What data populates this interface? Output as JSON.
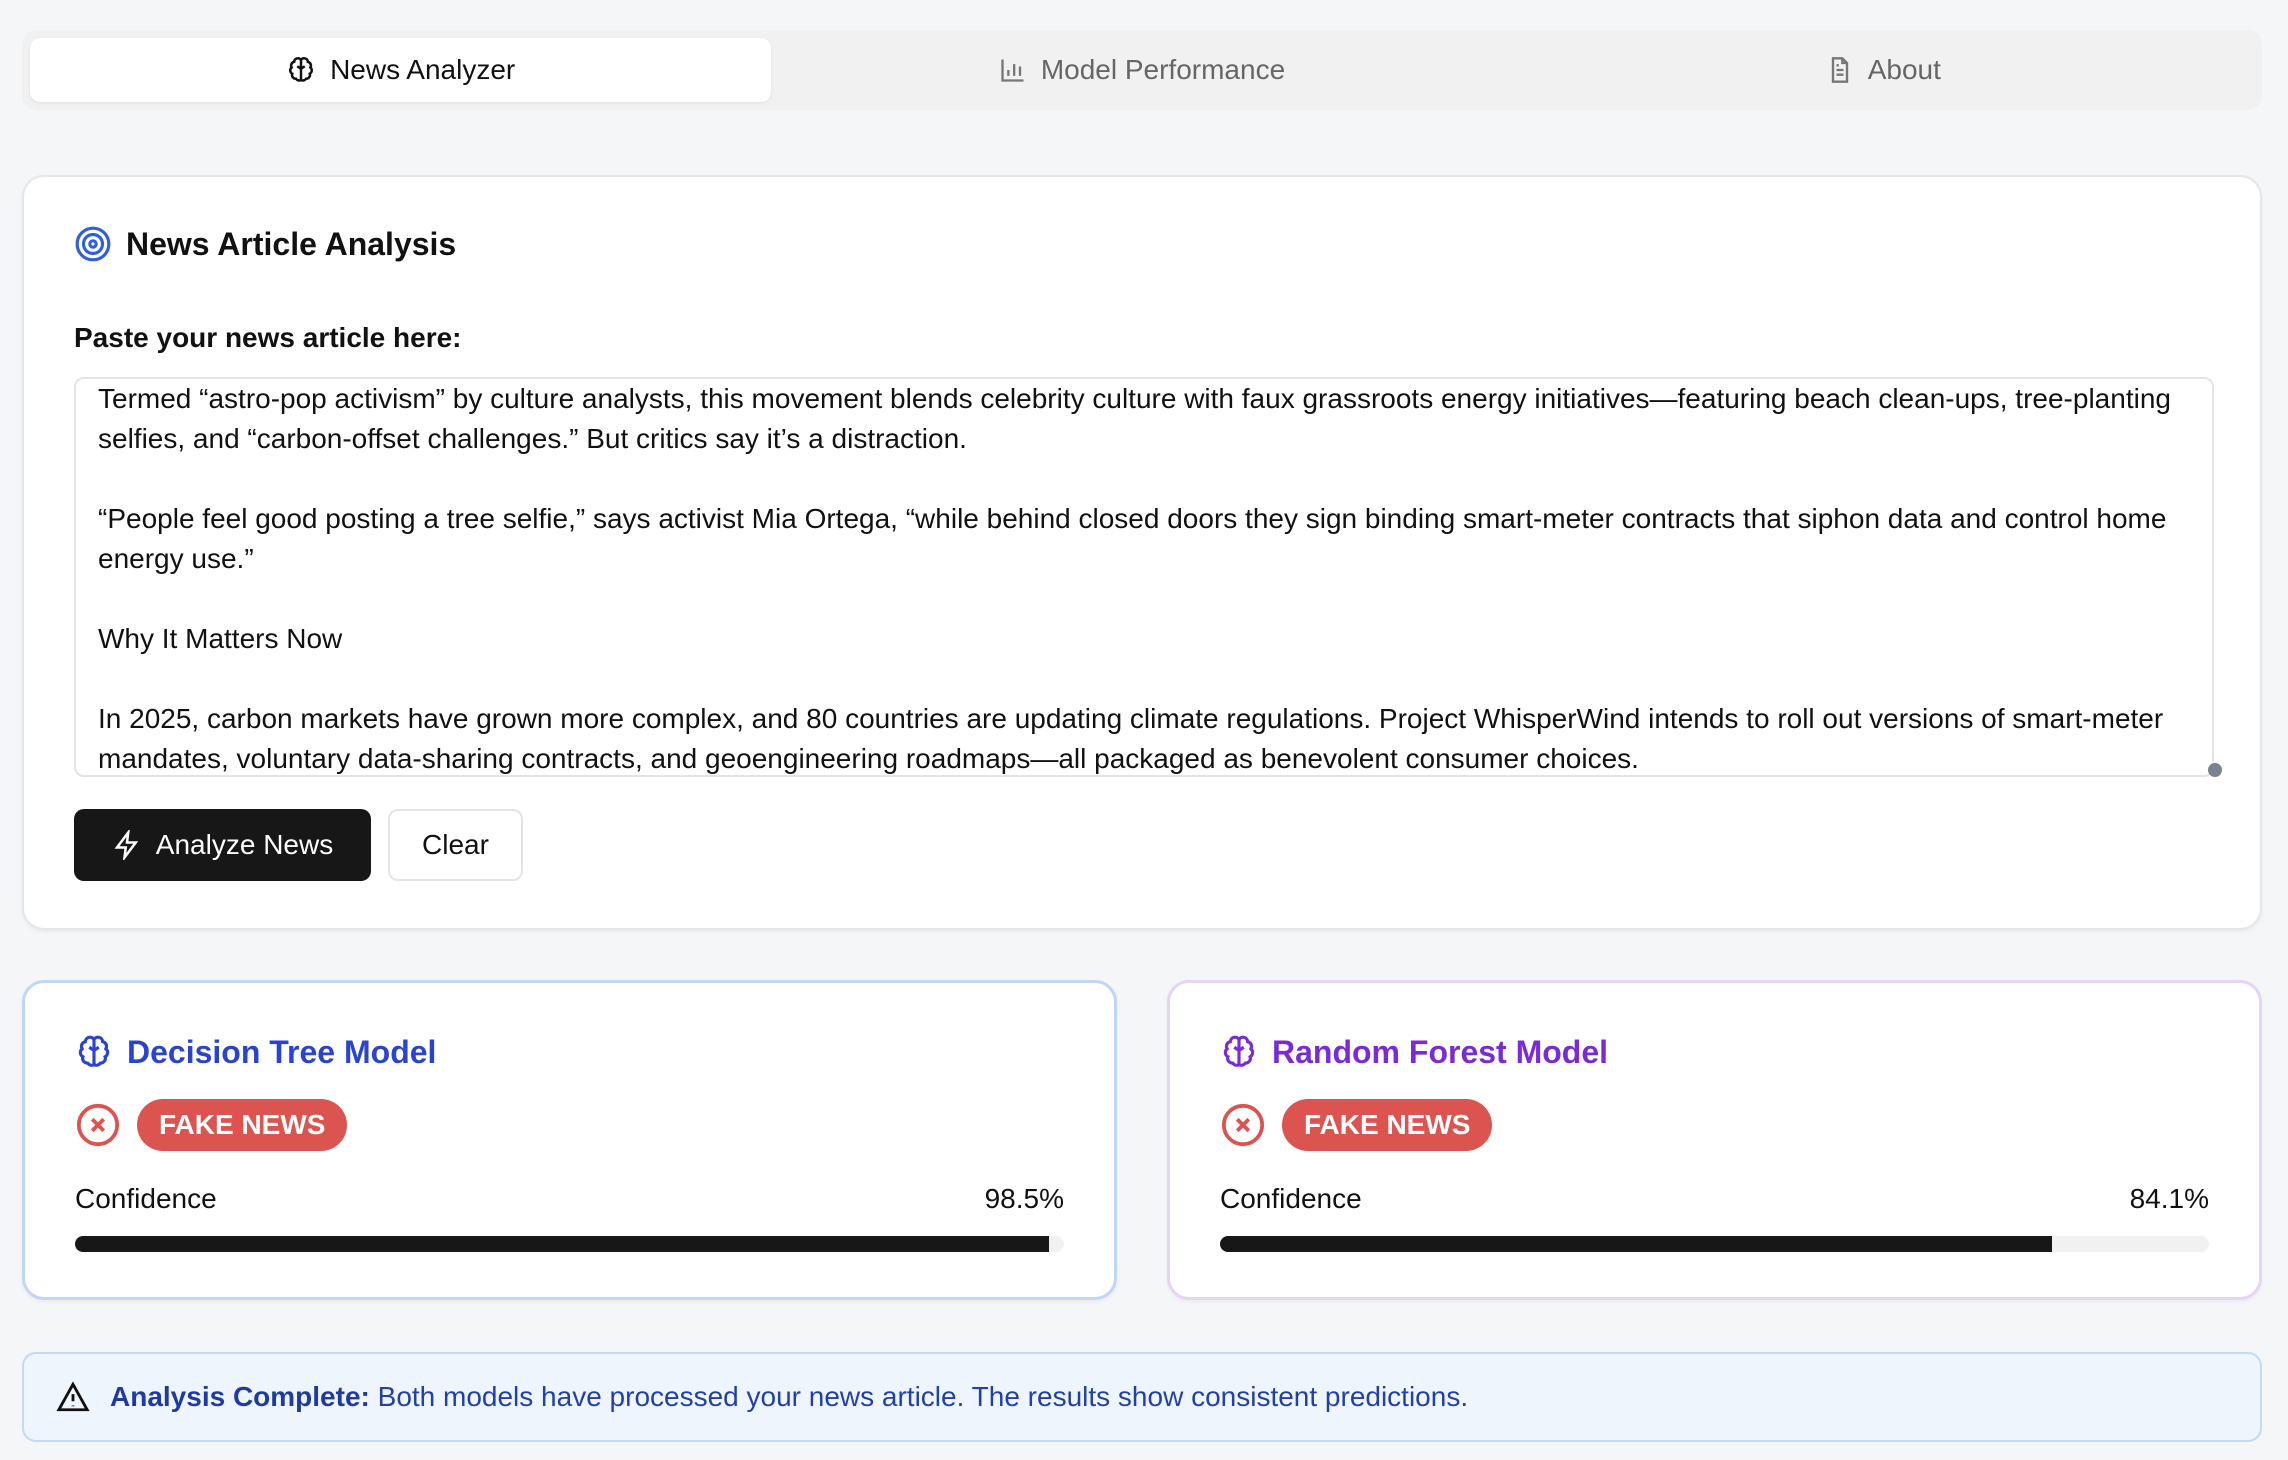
{
  "tabs": [
    {
      "label": "News Analyzer",
      "icon": "brain-icon",
      "active": true
    },
    {
      "label": "Model Performance",
      "icon": "bar-chart-icon"
    },
    {
      "label": "About",
      "icon": "document-icon"
    }
  ],
  "analysis": {
    "title": "News Article Analysis",
    "icon": "target-icon",
    "label": "Paste your news article here:",
    "article": "Termed “astro-pop activism” by culture analysts, this movement blends celebrity culture with faux grassroots energy initiatives—featuring beach clean-ups, tree-planting selfies, and “carbon-offset challenges.” But critics say it’s a distraction.\n\n“People feel good posting a tree selfie,” says activist Mia Ortega, “while behind closed doors they sign binding smart-meter contracts that siphon data and control home energy use.”\n\nWhy It Matters Now\n\nIn 2025, carbon markets have grown more complex, and 80 countries are updating climate regulations. Project WhisperWind intends to roll out versions of smart-meter mandates, voluntary data-sharing contracts, and geoengineering roadmaps—all packaged as benevolent consumer choices.",
    "analyze_label": "Analyze News",
    "clear_label": "Clear"
  },
  "models": [
    {
      "name": "Decision Tree Model",
      "color": "#2a44d0",
      "verdict": "FAKE NEWS",
      "confidence_label": "Confidence",
      "confidence": "98.5%",
      "confidence_value": 98.5
    },
    {
      "name": "Random Forest Model",
      "color": "#7a2bd8",
      "verdict": "FAKE NEWS",
      "confidence_label": "Confidence",
      "confidence": "84.1%",
      "confidence_value": 84.1
    }
  ],
  "alert": {
    "title": "Analysis Complete:",
    "message": "Both models have processed your news article. The results show consistent predictions."
  },
  "colors": {
    "fake": "#dc5450",
    "primary": "#171717"
  }
}
